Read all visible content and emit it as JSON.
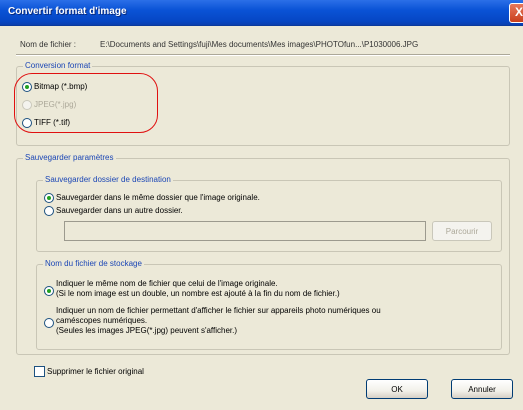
{
  "window": {
    "title": "Convertir format d'image",
    "close_label": "X"
  },
  "file": {
    "label": "Nom de fichier :",
    "value": "E:\\Documents and Settings\\fuji\\Mes documents\\Mes images\\PHOTOfun...\\P1030006.JPG"
  },
  "conversion": {
    "title": "Conversion format",
    "options": [
      {
        "label": "Bitmap (*.bmp)",
        "checked": true,
        "disabled": false
      },
      {
        "label": "JPEG(*.jpg)",
        "checked": false,
        "disabled": true
      },
      {
        "label": "TIFF (*.tif)",
        "checked": false,
        "disabled": false
      }
    ]
  },
  "save": {
    "title": "Sauvegarder paramètres",
    "destination": {
      "title": "Sauvegarder dossier de destination",
      "same_folder": "Sauvegarder dans le même dossier que l'image originale.",
      "other_folder": "Sauvegarder dans un autre dossier.",
      "path_value": "",
      "browse": "Parcourir"
    },
    "storage_name": {
      "title": "Nom du fichier de stockage",
      "same_name_line1": "Indiquer le même nom de fichier que celui de l'image originale.",
      "same_name_line2": "(Si le nom image est un double, un nombre est ajouté à la fin du nom de fichier.)",
      "camera_name_line1": "Indiquer un nom de fichier permettant d'afficher le fichier sur appareils photo numériques ou",
      "camera_name_line2": "caméscopes numériques.",
      "camera_name_line3": "(Seules les images JPEG(*.jpg) peuvent s'afficher.)"
    }
  },
  "delete_original": "Supprimer le fichier original",
  "buttons": {
    "ok": "OK",
    "cancel": "Annuler"
  }
}
